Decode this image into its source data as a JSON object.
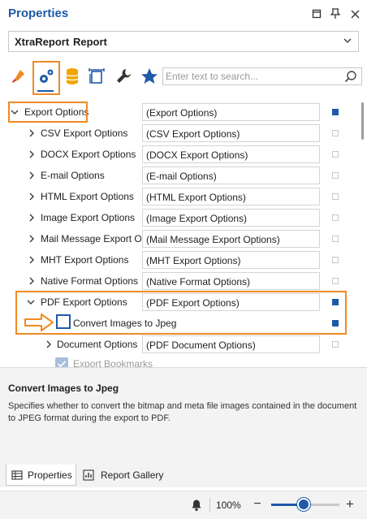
{
  "panel": {
    "title": "Properties",
    "pin_icon": "pin-icon",
    "close_icon": "close-icon",
    "menu_icon": "panel-menu-icon"
  },
  "selector": {
    "name": "XtraReport",
    "kind": "Report"
  },
  "toolbar": {
    "icons": [
      "appearance-brush-icon",
      "behavior-gears-icon",
      "data-database-icon",
      "layout-design-icon",
      "actions-wrench-icon",
      "favorites-star-icon"
    ],
    "search_placeholder": "Enter text to search..."
  },
  "grid": {
    "rows": [
      {
        "label": "Export Options",
        "value": "(Export Options)",
        "expanded": true,
        "modified": true
      },
      {
        "label": "CSV Export Options",
        "value": "(CSV Export Options)",
        "expanded": false,
        "modified": false
      },
      {
        "label": "DOCX Export Options",
        "value": "(DOCX Export Options)",
        "expanded": false,
        "modified": false
      },
      {
        "label": "E-mail Options",
        "value": "(E-mail Options)",
        "expanded": false,
        "modified": false
      },
      {
        "label": "HTML Export Options",
        "value": "(HTML Export Options)",
        "expanded": false,
        "modified": false
      },
      {
        "label": "Image Export Options",
        "value": "(Image Export Options)",
        "expanded": false,
        "modified": false
      },
      {
        "label": "Mail Message Export Op...",
        "value": "(Mail Message Export Options)",
        "expanded": false,
        "modified": false
      },
      {
        "label": "MHT Export Options",
        "value": "(MHT Export Options)",
        "expanded": false,
        "modified": false
      },
      {
        "label": "Native Format Options",
        "value": "(Native Format Options)",
        "expanded": false,
        "modified": false
      },
      {
        "label": "PDF Export Options",
        "value": "(PDF Export Options)",
        "expanded": true,
        "modified": true
      },
      {
        "label": "Convert Images to Jpeg",
        "value": "",
        "expanded": false,
        "modified": true
      },
      {
        "label": "Document Options",
        "value": "(PDF Document Options)",
        "expanded": false,
        "modified": false
      },
      {
        "label": "Export Bookmarks",
        "value": "",
        "expanded": false,
        "modified": false
      }
    ],
    "accent_color": "#1e5aa8",
    "highlight_color": "#f08a24"
  },
  "description": {
    "title": "Convert Images to Jpeg",
    "text": "Specifies whether to convert the bitmap and meta file images contained in the document to JPEG format during the export to PDF."
  },
  "tabs": [
    {
      "label": "Properties",
      "active": true
    },
    {
      "label": "Report Gallery",
      "active": false
    }
  ],
  "status": {
    "zoom": "100%",
    "zoom_fraction": 0.48
  }
}
